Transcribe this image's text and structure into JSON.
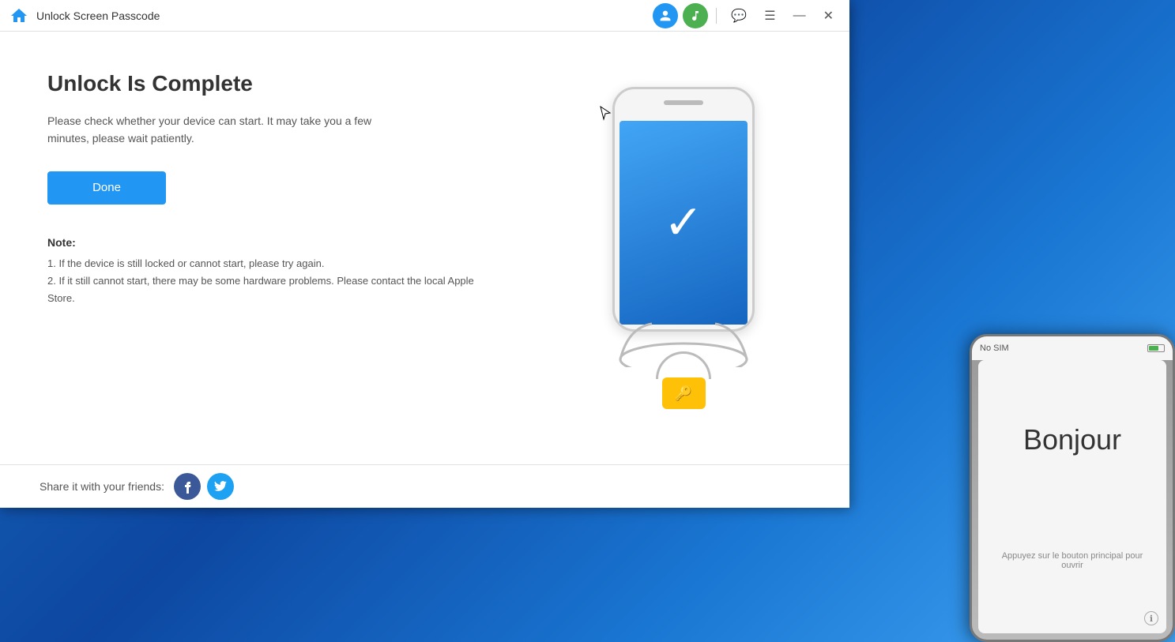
{
  "titleBar": {
    "title": "Unlock Screen Passcode",
    "userIconLabel": "user",
    "musicIconLabel": "music-note"
  },
  "windowControls": {
    "comment": "💬",
    "menu": "☰",
    "minimize": "—",
    "close": "✕"
  },
  "main": {
    "heading": "Unlock Is Complete",
    "description": "Please check whether your device can start. It may take you a few minutes, please wait patiently.",
    "doneButton": "Done",
    "note": {
      "label": "Note:",
      "items": [
        "1. If the device is still locked or cannot start, please try again.",
        "2. If it still cannot start, there may be some hardware problems. Please contact the local Apple Store."
      ]
    }
  },
  "footer": {
    "shareLabel": "Share it with your friends:",
    "facebookLabel": "f",
    "twitterLabel": "t"
  },
  "desktopPhone": {
    "noSim": "No SIM",
    "bonjour": "Bonjour",
    "homeText": "Appuyez sur le bouton principal pour ouvrir",
    "infoBtn": "ℹ"
  }
}
